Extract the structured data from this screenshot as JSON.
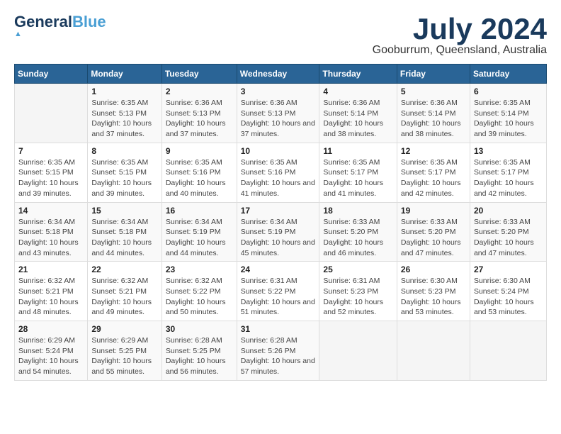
{
  "header": {
    "logo_line1": "General",
    "logo_line1_accent": "Blue",
    "month_year": "July 2024",
    "location": "Gooburrum, Queensland, Australia"
  },
  "weekdays": [
    "Sunday",
    "Monday",
    "Tuesday",
    "Wednesday",
    "Thursday",
    "Friday",
    "Saturday"
  ],
  "weeks": [
    [
      {
        "day": "",
        "empty": true
      },
      {
        "day": "1",
        "sunrise": "6:35 AM",
        "sunset": "5:13 PM",
        "daylight": "10 hours and 37 minutes."
      },
      {
        "day": "2",
        "sunrise": "6:36 AM",
        "sunset": "5:13 PM",
        "daylight": "10 hours and 37 minutes."
      },
      {
        "day": "3",
        "sunrise": "6:36 AM",
        "sunset": "5:13 PM",
        "daylight": "10 hours and 37 minutes."
      },
      {
        "day": "4",
        "sunrise": "6:36 AM",
        "sunset": "5:14 PM",
        "daylight": "10 hours and 38 minutes."
      },
      {
        "day": "5",
        "sunrise": "6:36 AM",
        "sunset": "5:14 PM",
        "daylight": "10 hours and 38 minutes."
      },
      {
        "day": "6",
        "sunrise": "6:35 AM",
        "sunset": "5:14 PM",
        "daylight": "10 hours and 39 minutes."
      }
    ],
    [
      {
        "day": "7",
        "sunrise": "6:35 AM",
        "sunset": "5:15 PM",
        "daylight": "10 hours and 39 minutes."
      },
      {
        "day": "8",
        "sunrise": "6:35 AM",
        "sunset": "5:15 PM",
        "daylight": "10 hours and 39 minutes."
      },
      {
        "day": "9",
        "sunrise": "6:35 AM",
        "sunset": "5:16 PM",
        "daylight": "10 hours and 40 minutes."
      },
      {
        "day": "10",
        "sunrise": "6:35 AM",
        "sunset": "5:16 PM",
        "daylight": "10 hours and 41 minutes."
      },
      {
        "day": "11",
        "sunrise": "6:35 AM",
        "sunset": "5:17 PM",
        "daylight": "10 hours and 41 minutes."
      },
      {
        "day": "12",
        "sunrise": "6:35 AM",
        "sunset": "5:17 PM",
        "daylight": "10 hours and 42 minutes."
      },
      {
        "day": "13",
        "sunrise": "6:35 AM",
        "sunset": "5:17 PM",
        "daylight": "10 hours and 42 minutes."
      }
    ],
    [
      {
        "day": "14",
        "sunrise": "6:34 AM",
        "sunset": "5:18 PM",
        "daylight": "10 hours and 43 minutes."
      },
      {
        "day": "15",
        "sunrise": "6:34 AM",
        "sunset": "5:18 PM",
        "daylight": "10 hours and 44 minutes."
      },
      {
        "day": "16",
        "sunrise": "6:34 AM",
        "sunset": "5:19 PM",
        "daylight": "10 hours and 44 minutes."
      },
      {
        "day": "17",
        "sunrise": "6:34 AM",
        "sunset": "5:19 PM",
        "daylight": "10 hours and 45 minutes."
      },
      {
        "day": "18",
        "sunrise": "6:33 AM",
        "sunset": "5:20 PM",
        "daylight": "10 hours and 46 minutes."
      },
      {
        "day": "19",
        "sunrise": "6:33 AM",
        "sunset": "5:20 PM",
        "daylight": "10 hours and 47 minutes."
      },
      {
        "day": "20",
        "sunrise": "6:33 AM",
        "sunset": "5:20 PM",
        "daylight": "10 hours and 47 minutes."
      }
    ],
    [
      {
        "day": "21",
        "sunrise": "6:32 AM",
        "sunset": "5:21 PM",
        "daylight": "10 hours and 48 minutes."
      },
      {
        "day": "22",
        "sunrise": "6:32 AM",
        "sunset": "5:21 PM",
        "daylight": "10 hours and 49 minutes."
      },
      {
        "day": "23",
        "sunrise": "6:32 AM",
        "sunset": "5:22 PM",
        "daylight": "10 hours and 50 minutes."
      },
      {
        "day": "24",
        "sunrise": "6:31 AM",
        "sunset": "5:22 PM",
        "daylight": "10 hours and 51 minutes."
      },
      {
        "day": "25",
        "sunrise": "6:31 AM",
        "sunset": "5:23 PM",
        "daylight": "10 hours and 52 minutes."
      },
      {
        "day": "26",
        "sunrise": "6:30 AM",
        "sunset": "5:23 PM",
        "daylight": "10 hours and 53 minutes."
      },
      {
        "day": "27",
        "sunrise": "6:30 AM",
        "sunset": "5:24 PM",
        "daylight": "10 hours and 53 minutes."
      }
    ],
    [
      {
        "day": "28",
        "sunrise": "6:29 AM",
        "sunset": "5:24 PM",
        "daylight": "10 hours and 54 minutes."
      },
      {
        "day": "29",
        "sunrise": "6:29 AM",
        "sunset": "5:25 PM",
        "daylight": "10 hours and 55 minutes."
      },
      {
        "day": "30",
        "sunrise": "6:28 AM",
        "sunset": "5:25 PM",
        "daylight": "10 hours and 56 minutes."
      },
      {
        "day": "31",
        "sunrise": "6:28 AM",
        "sunset": "5:26 PM",
        "daylight": "10 hours and 57 minutes."
      },
      {
        "day": "",
        "empty": true
      },
      {
        "day": "",
        "empty": true
      },
      {
        "day": "",
        "empty": true
      }
    ]
  ]
}
